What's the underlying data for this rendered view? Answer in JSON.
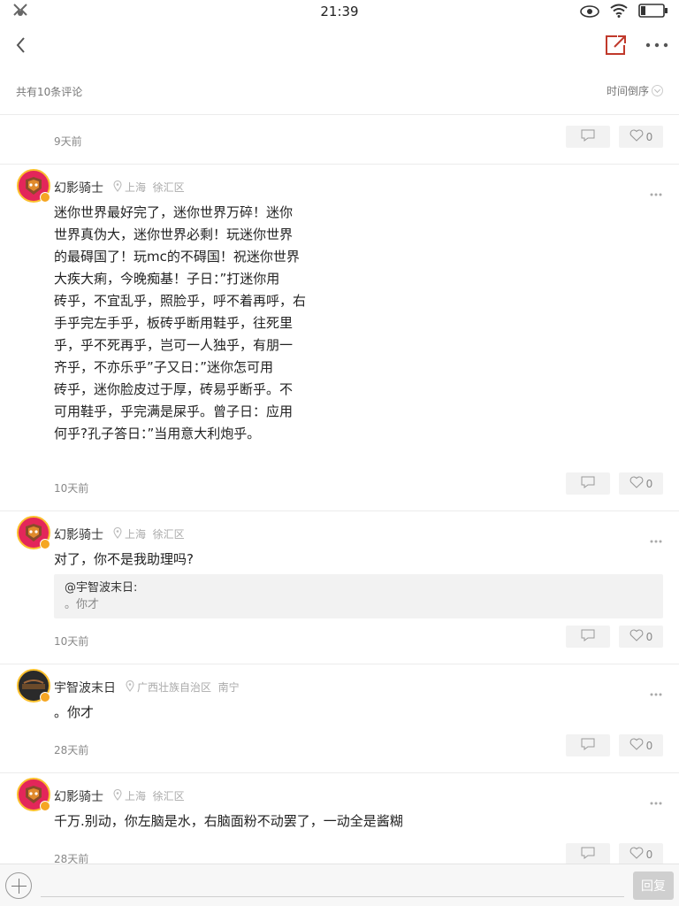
{
  "status": {
    "time": "21:39"
  },
  "list_header": {
    "count_label": "共有10条评论",
    "sort_label": "时间倒序"
  },
  "partial_comment": {
    "time": "9天前",
    "likes": "0"
  },
  "comments": [
    {
      "user": "幻影骑士",
      "location": "上海  徐汇区",
      "text_lines": [
        "迷你世界最好完了，迷你世界万碎！迷你",
        "世界真伪大，迷你世界必剩！玩迷你世界",
        "的最碍国了！玩mc的不碍国！祝迷你世界",
        "大疾大痢，今晚痴基！子日：”打迷你用",
        "砖乎，不宜乱乎，照脸乎，呼不着再呼，右",
        "手乎完左手乎，板砖乎断用鞋乎，往死里",
        "乎，乎不死再乎，岂可一人独乎，有朋一",
        "齐乎，不亦乐乎”子又日：”迷你怎可用",
        "砖乎，迷你脸皮过于厚，砖易乎断乎。不",
        "可用鞋乎，乎完满是屎乎。曾子日：应用",
        "何乎?孔子答日：”当用意大利炮乎。"
      ],
      "time": "10天前",
      "likes": "0"
    },
    {
      "user": "幻影骑士",
      "location": "上海  徐汇区",
      "text": "对了，你不是我助理吗?",
      "quote_author": "@宇智波末日:",
      "quote_text": "。你才",
      "time": "10天前",
      "likes": "0"
    },
    {
      "user": "宇智波末日",
      "location": "广西壮族自治区  南宁",
      "text": "。你才",
      "time": "28天前",
      "likes": "0"
    },
    {
      "user": "幻影骑士",
      "location": "上海  徐汇区",
      "text": "千万.别动，你左脑是水，右脑面粉不动罢了，一动全是酱糊",
      "time": "28天前",
      "likes": "0"
    }
  ],
  "bottom_bar": {
    "submit_label": "回复"
  },
  "icons": {
    "back": "chevron-left-icon",
    "share": "share-external-icon",
    "more": "more-horizontal-icon",
    "reply": "comment-bubble-icon",
    "like": "heart-outline-icon",
    "location": "location-pin-icon",
    "add": "plus-circle-icon"
  },
  "colors": {
    "share_icon": "#c0392b",
    "avatar_bg": "#e3265a",
    "avatar_badge": "#f5a623",
    "submit_bg": "#cfcfcf"
  }
}
